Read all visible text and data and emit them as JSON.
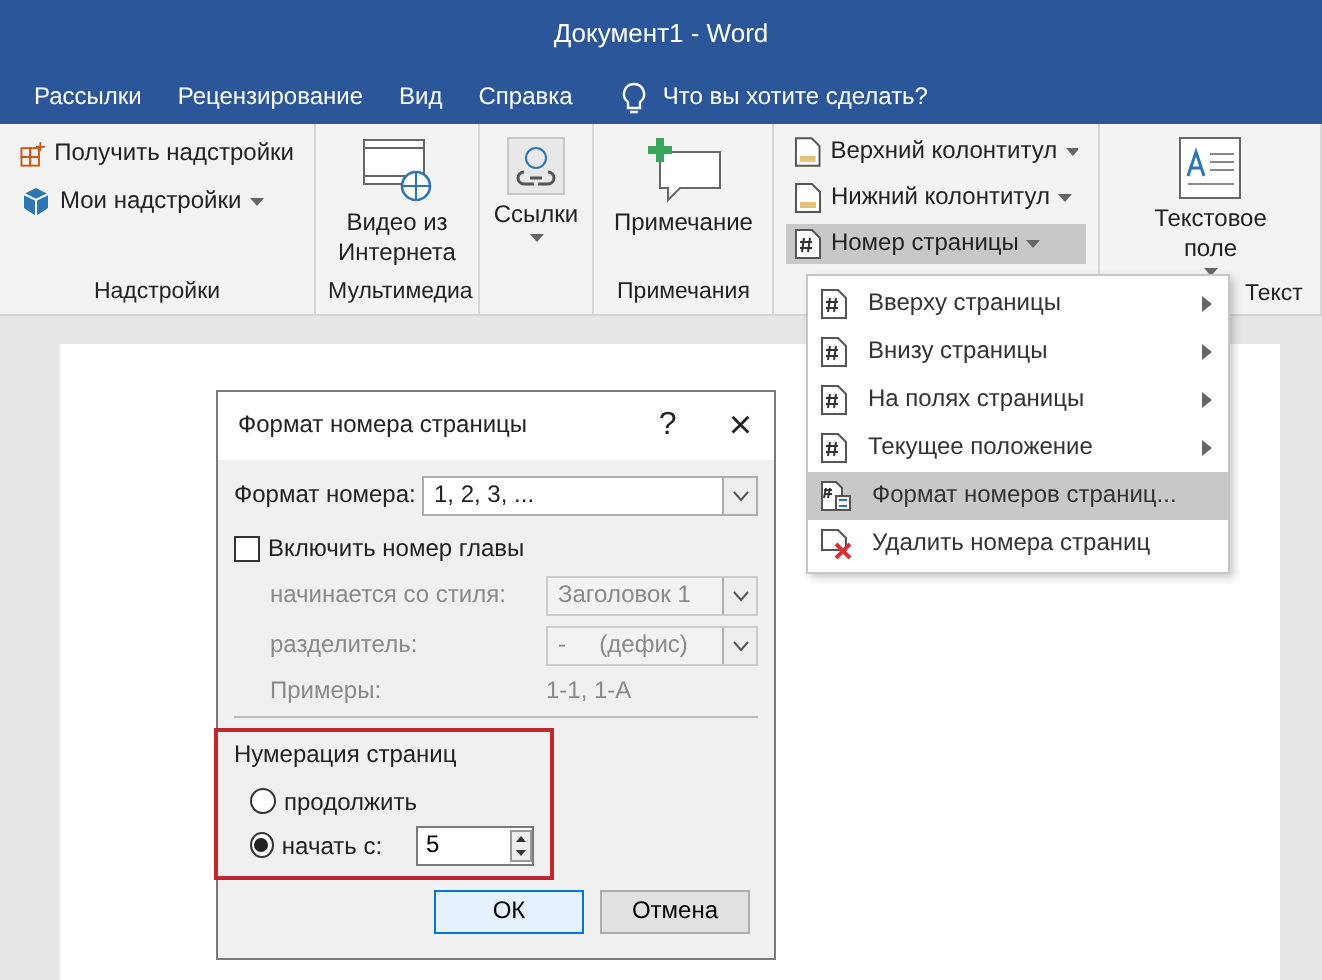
{
  "window": {
    "title": "Документ1  -  Word"
  },
  "tabs": [
    {
      "label": "Рассылки"
    },
    {
      "label": "Рецензирование"
    },
    {
      "label": "Вид"
    },
    {
      "label": "Справка"
    }
  ],
  "tell_me": {
    "placeholder": "Что вы хотите сделать?"
  },
  "ribbon": {
    "groups": [
      {
        "label": "Надстройки",
        "kind": "list",
        "items": [
          {
            "label": "Получить надстройки",
            "dropdown": false,
            "selected": false
          },
          {
            "label": "Мои надстройки",
            "dropdown": true,
            "selected": false
          }
        ]
      },
      {
        "label": "Мультимедиа",
        "kind": "large",
        "items": [
          {
            "label": "Видео из Интернета",
            "dropdown": false,
            "selected": false
          }
        ]
      },
      {
        "kind": "large",
        "items": [
          {
            "label": "Ссылки",
            "dropdown": true,
            "selected": false
          }
        ]
      },
      {
        "label": "Примечания",
        "kind": "large",
        "items": [
          {
            "label": "Примечание",
            "dropdown": false,
            "selected": false
          }
        ]
      },
      {
        "kind": "list",
        "items": [
          {
            "label": "Верхний колонтитул",
            "dropdown": true,
            "selected": false
          },
          {
            "label": "Нижний колонтитул",
            "dropdown": true,
            "selected": false
          },
          {
            "label": "Номер страницы",
            "dropdown": true,
            "selected": true
          }
        ]
      },
      {
        "label": "Текст",
        "kind": "large",
        "items": [
          {
            "label": "Текстовое поле",
            "dropdown": true,
            "selected": false
          }
        ]
      }
    ]
  },
  "menu": {
    "items": [
      {
        "label": "Вверху страницы",
        "submenu": true,
        "selected": false
      },
      {
        "label": "Внизу страницы",
        "submenu": true,
        "selected": false
      },
      {
        "label": "На полях страницы",
        "submenu": true,
        "selected": false
      },
      {
        "label": "Текущее положение",
        "submenu": true,
        "selected": false
      },
      {
        "label": "Формат номеров страниц...",
        "submenu": false,
        "selected": true
      },
      {
        "label": "Удалить номера страниц",
        "submenu": false,
        "selected": false
      }
    ]
  },
  "dialog": {
    "title": "Формат номера страницы",
    "help": "?",
    "close": "×",
    "number_format": {
      "label": "Формат номера:",
      "value": "1, 2, 3, ..."
    },
    "include_chapter": {
      "label": "Включить номер главы",
      "checked": false
    },
    "chapter_fields": [
      {
        "label": "начинается со стиля:",
        "value": "Заголовок 1",
        "disabled": true
      },
      {
        "label": "разделитель:",
        "value": "-     (дефис)",
        "disabled": true
      }
    ],
    "examples": {
      "label": "Примеры:",
      "value": "1-1, 1-A",
      "disabled": true
    },
    "numbering": {
      "title": "Нумерация страниц",
      "highlighted": true,
      "options": [
        {
          "label": "продолжить",
          "selected": false
        },
        {
          "label": "начать с:",
          "selected": true,
          "value": "5"
        }
      ]
    },
    "buttons": [
      {
        "label": "ОК",
        "selected": true
      },
      {
        "label": "Отмена",
        "selected": false
      }
    ]
  }
}
